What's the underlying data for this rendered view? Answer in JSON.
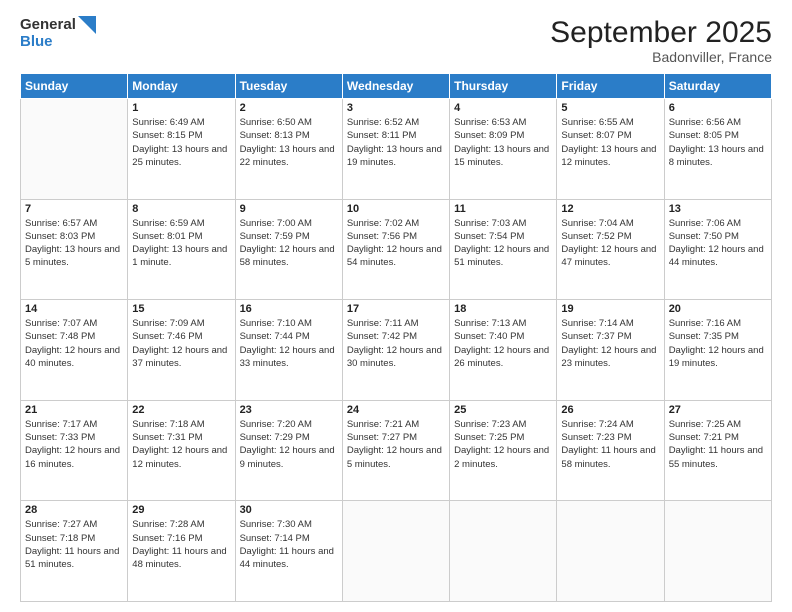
{
  "header": {
    "logo_general": "General",
    "logo_blue": "Blue",
    "title": "September 2025",
    "subtitle": "Badonviller, France"
  },
  "weekdays": [
    "Sunday",
    "Monday",
    "Tuesday",
    "Wednesday",
    "Thursday",
    "Friday",
    "Saturday"
  ],
  "weeks": [
    [
      {
        "day": "",
        "content": ""
      },
      {
        "day": "1",
        "content": "Sunrise: 6:49 AM\nSunset: 8:15 PM\nDaylight: 13 hours and 25 minutes."
      },
      {
        "day": "2",
        "content": "Sunrise: 6:50 AM\nSunset: 8:13 PM\nDaylight: 13 hours and 22 minutes."
      },
      {
        "day": "3",
        "content": "Sunrise: 6:52 AM\nSunset: 8:11 PM\nDaylight: 13 hours and 19 minutes."
      },
      {
        "day": "4",
        "content": "Sunrise: 6:53 AM\nSunset: 8:09 PM\nDaylight: 13 hours and 15 minutes."
      },
      {
        "day": "5",
        "content": "Sunrise: 6:55 AM\nSunset: 8:07 PM\nDaylight: 13 hours and 12 minutes."
      },
      {
        "day": "6",
        "content": "Sunrise: 6:56 AM\nSunset: 8:05 PM\nDaylight: 13 hours and 8 minutes."
      }
    ],
    [
      {
        "day": "7",
        "content": "Sunrise: 6:57 AM\nSunset: 8:03 PM\nDaylight: 13 hours and 5 minutes."
      },
      {
        "day": "8",
        "content": "Sunrise: 6:59 AM\nSunset: 8:01 PM\nDaylight: 13 hours and 1 minute."
      },
      {
        "day": "9",
        "content": "Sunrise: 7:00 AM\nSunset: 7:59 PM\nDaylight: 12 hours and 58 minutes."
      },
      {
        "day": "10",
        "content": "Sunrise: 7:02 AM\nSunset: 7:56 PM\nDaylight: 12 hours and 54 minutes."
      },
      {
        "day": "11",
        "content": "Sunrise: 7:03 AM\nSunset: 7:54 PM\nDaylight: 12 hours and 51 minutes."
      },
      {
        "day": "12",
        "content": "Sunrise: 7:04 AM\nSunset: 7:52 PM\nDaylight: 12 hours and 47 minutes."
      },
      {
        "day": "13",
        "content": "Sunrise: 7:06 AM\nSunset: 7:50 PM\nDaylight: 12 hours and 44 minutes."
      }
    ],
    [
      {
        "day": "14",
        "content": "Sunrise: 7:07 AM\nSunset: 7:48 PM\nDaylight: 12 hours and 40 minutes."
      },
      {
        "day": "15",
        "content": "Sunrise: 7:09 AM\nSunset: 7:46 PM\nDaylight: 12 hours and 37 minutes."
      },
      {
        "day": "16",
        "content": "Sunrise: 7:10 AM\nSunset: 7:44 PM\nDaylight: 12 hours and 33 minutes."
      },
      {
        "day": "17",
        "content": "Sunrise: 7:11 AM\nSunset: 7:42 PM\nDaylight: 12 hours and 30 minutes."
      },
      {
        "day": "18",
        "content": "Sunrise: 7:13 AM\nSunset: 7:40 PM\nDaylight: 12 hours and 26 minutes."
      },
      {
        "day": "19",
        "content": "Sunrise: 7:14 AM\nSunset: 7:37 PM\nDaylight: 12 hours and 23 minutes."
      },
      {
        "day": "20",
        "content": "Sunrise: 7:16 AM\nSunset: 7:35 PM\nDaylight: 12 hours and 19 minutes."
      }
    ],
    [
      {
        "day": "21",
        "content": "Sunrise: 7:17 AM\nSunset: 7:33 PM\nDaylight: 12 hours and 16 minutes."
      },
      {
        "day": "22",
        "content": "Sunrise: 7:18 AM\nSunset: 7:31 PM\nDaylight: 12 hours and 12 minutes."
      },
      {
        "day": "23",
        "content": "Sunrise: 7:20 AM\nSunset: 7:29 PM\nDaylight: 12 hours and 9 minutes."
      },
      {
        "day": "24",
        "content": "Sunrise: 7:21 AM\nSunset: 7:27 PM\nDaylight: 12 hours and 5 minutes."
      },
      {
        "day": "25",
        "content": "Sunrise: 7:23 AM\nSunset: 7:25 PM\nDaylight: 12 hours and 2 minutes."
      },
      {
        "day": "26",
        "content": "Sunrise: 7:24 AM\nSunset: 7:23 PM\nDaylight: 11 hours and 58 minutes."
      },
      {
        "day": "27",
        "content": "Sunrise: 7:25 AM\nSunset: 7:21 PM\nDaylight: 11 hours and 55 minutes."
      }
    ],
    [
      {
        "day": "28",
        "content": "Sunrise: 7:27 AM\nSunset: 7:18 PM\nDaylight: 11 hours and 51 minutes."
      },
      {
        "day": "29",
        "content": "Sunrise: 7:28 AM\nSunset: 7:16 PM\nDaylight: 11 hours and 48 minutes."
      },
      {
        "day": "30",
        "content": "Sunrise: 7:30 AM\nSunset: 7:14 PM\nDaylight: 11 hours and 44 minutes."
      },
      {
        "day": "",
        "content": ""
      },
      {
        "day": "",
        "content": ""
      },
      {
        "day": "",
        "content": ""
      },
      {
        "day": "",
        "content": ""
      }
    ]
  ]
}
